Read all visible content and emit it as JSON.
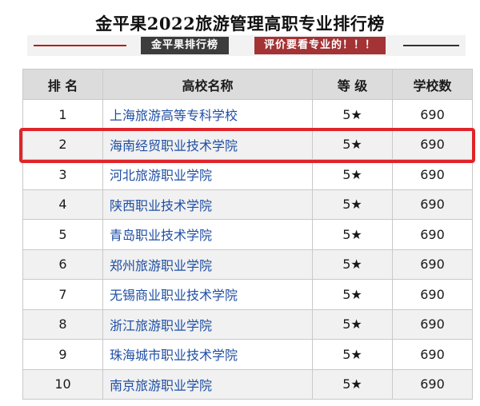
{
  "page": {
    "title": "金平果2022旅游管理高职专业排行榜",
    "banner": {
      "tag_left": "金平果排行榜",
      "tag_right": "评价要看专业的！！！"
    }
  },
  "table": {
    "headers": [
      "排 名",
      "高校名称",
      "等 级",
      "学校数"
    ],
    "rows": [
      {
        "rank": "1",
        "school": "上海旅游高等专科学校",
        "level": "5★",
        "count": "690"
      },
      {
        "rank": "2",
        "school": "海南经贸职业技术学院",
        "level": "5★",
        "count": "690"
      },
      {
        "rank": "3",
        "school": "河北旅游职业学院",
        "level": "5★",
        "count": "690"
      },
      {
        "rank": "4",
        "school": "陕西职业技术学院",
        "level": "5★",
        "count": "690"
      },
      {
        "rank": "5",
        "school": "青岛职业技术学院",
        "level": "5★",
        "count": "690"
      },
      {
        "rank": "6",
        "school": "郑州旅游职业学院",
        "level": "5★",
        "count": "690"
      },
      {
        "rank": "7",
        "school": "无锡商业职业技术学院",
        "level": "5★",
        "count": "690"
      },
      {
        "rank": "8",
        "school": "浙江旅游职业学院",
        "level": "5★",
        "count": "690"
      },
      {
        "rank": "9",
        "school": "珠海城市职业技术学院",
        "level": "5★",
        "count": "690"
      },
      {
        "rank": "10",
        "school": "南京旅游职业学院",
        "level": "5★",
        "count": "690"
      }
    ],
    "highlighted_rank": "2"
  },
  "colors": {
    "highlight": "#e0242a",
    "school_link": "#1f4fa3",
    "tag_red": "#a33335",
    "tag_dark": "#3c3c3c"
  }
}
